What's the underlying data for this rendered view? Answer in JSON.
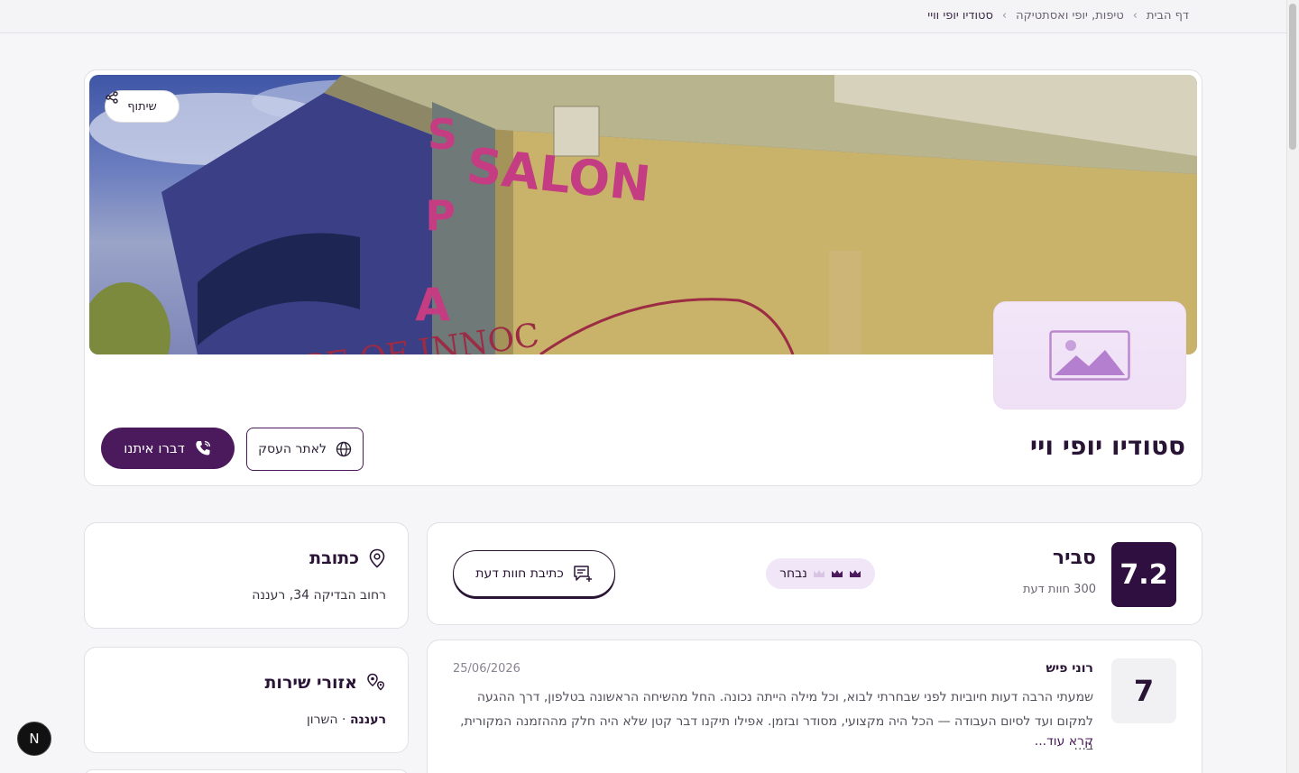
{
  "breadcrumb": {
    "items": [
      "דף הבית",
      "טיפות, יופי ואסתטיקה",
      "סטודיו יופי וויי"
    ],
    "separator": "›"
  },
  "hero": {
    "share_label": "שיתוף",
    "business_name": "סטודיו יופי ויי",
    "call_label": "דברו איתנו",
    "site_label": "לאתר העסק",
    "cover_sign_vertical": [
      "S",
      "P",
      "A"
    ],
    "cover_sign_main": "SALON",
    "cover_sign_script": "AGE OF INNOC"
  },
  "rating": {
    "score": "7.2",
    "label": "סביר",
    "count": "300 חוות דעת",
    "badge_label": "נבחר",
    "write_review_label": "כתיבת חוות דעת"
  },
  "review": {
    "score": "7",
    "reviewer": "רוני פיש",
    "date": "25/06/2026",
    "text": "שמעתי הרבה דעות חיוביות לפני שבחרתי לבוא, וכל מילה הייתה נכונה. החל מהשיחה הראשונה בטלפון, דרך ההגעה למקום ועד לסיום העבודה — הכל היה מקצועי, מסודר ובזמן. אפילו תיקנו דבר קטן שלא היה חלק מההזמנה המקורית, ב...",
    "read_more": "קרא עוד..."
  },
  "address": {
    "title": "כתובת",
    "value": "רחוב הבדיקה 34, רעננה"
  },
  "service_areas": {
    "title": "אזורי שירות",
    "primary": "רעננה",
    "rest": " · השרון"
  },
  "fab_letter": "N",
  "colors": {
    "brand": "#4b1a5c",
    "score_dark": "#2f0f3f",
    "badge_bg": "#f1e6f7"
  }
}
